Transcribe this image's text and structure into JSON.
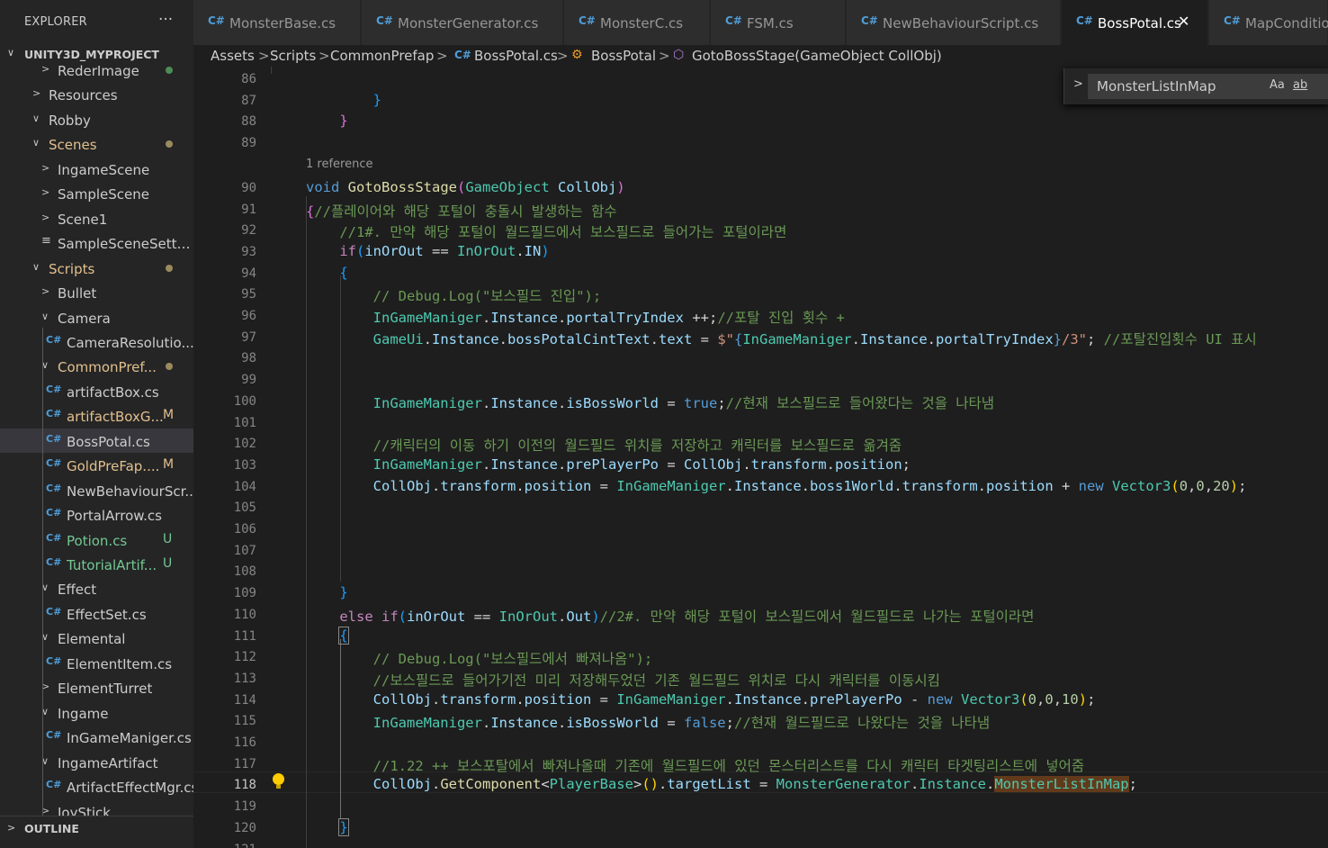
{
  "explorer": {
    "title": "EXPLORER",
    "more": "···",
    "root": "UNITY3D_MYPROJECT",
    "items": [
      {
        "label": "RederImage",
        "type": "folder",
        "open": false,
        "dot": "green"
      },
      {
        "label": "Resources",
        "type": "folder",
        "open": false
      },
      {
        "label": "Robby",
        "type": "folder",
        "open": true
      },
      {
        "label": "Scenes",
        "type": "folder",
        "open": true,
        "dot": "yellow",
        "status": "mod"
      },
      {
        "label": "IngameScene",
        "type": "folder",
        "open": false
      },
      {
        "label": "SampleScene",
        "type": "folder",
        "open": false
      },
      {
        "label": "Scene1",
        "type": "folder",
        "open": false
      },
      {
        "label": "SampleSceneSettin...",
        "type": "settings"
      },
      {
        "label": "Scripts",
        "type": "folder",
        "open": true,
        "dot": "yellow",
        "status": "mod"
      },
      {
        "label": "Bullet",
        "type": "folder",
        "open": false
      },
      {
        "label": "Camera",
        "type": "folder",
        "open": true
      },
      {
        "label": "CameraResolutio...",
        "type": "cs"
      },
      {
        "label": "CommonPref...",
        "type": "folder",
        "open": true,
        "dot": "yellow",
        "status": "mod"
      },
      {
        "label": "artifactBox.cs",
        "type": "cs"
      },
      {
        "label": "artifactBoxG...",
        "type": "cs",
        "status": "mod",
        "badge": "M"
      },
      {
        "label": "BossPotal.cs",
        "type": "cs",
        "selected": true
      },
      {
        "label": "GoldPreFap....",
        "type": "cs",
        "status": "mod",
        "badge": "M"
      },
      {
        "label": "NewBehaviourScr...",
        "type": "cs"
      },
      {
        "label": "PortalArrow.cs",
        "type": "cs"
      },
      {
        "label": "Potion.cs",
        "type": "cs",
        "status": "unt",
        "badge": "U"
      },
      {
        "label": "TutorialArtif...",
        "type": "cs",
        "status": "unt",
        "badge": "U"
      },
      {
        "label": "Effect",
        "type": "folder",
        "open": true
      },
      {
        "label": "EffectSet.cs",
        "type": "cs"
      },
      {
        "label": "Elemental",
        "type": "folder",
        "open": true
      },
      {
        "label": "ElementItem.cs",
        "type": "cs"
      },
      {
        "label": "ElementTurret",
        "type": "folder",
        "open": false
      },
      {
        "label": "Ingame",
        "type": "folder",
        "open": true
      },
      {
        "label": "InGameManiger.cs",
        "type": "cs"
      },
      {
        "label": "IngameArtifact",
        "type": "folder",
        "open": true
      },
      {
        "label": "ArtifactEffectMgr.cs",
        "type": "cs"
      },
      {
        "label": "JoyStick",
        "type": "folder",
        "open": false
      }
    ],
    "outline": "OUTLINE"
  },
  "tabs": [
    {
      "label": "MonsterBase.cs"
    },
    {
      "label": "MonsterGenerator.cs"
    },
    {
      "label": "MonsterC.cs"
    },
    {
      "label": "FSM.cs"
    },
    {
      "label": "NewBehaviourScript.cs"
    },
    {
      "label": "BossPotal.cs",
      "active": true,
      "close": "✕"
    },
    {
      "label": "MapConditio"
    }
  ],
  "breadcrumb": [
    "Assets",
    "Scripts",
    "CommonPrefap",
    "BossPotal.cs",
    "BossPotal",
    "GotoBossStage(GameObject CollObj)"
  ],
  "find": {
    "value": "MonsterListInMap",
    "match_case": "Aa",
    "whole_word": "ab"
  },
  "editor": {
    "reference_label": "1 reference",
    "current_line": "118",
    "lines": [
      {
        "n": "86",
        "tokens": []
      },
      {
        "n": "87",
        "tokens": [
          {
            "t": "        ",
            "c": "p"
          },
          {
            "t": "}",
            "c": "b3"
          }
        ]
      },
      {
        "n": "88",
        "tokens": [
          {
            "t": "    ",
            "c": "p"
          },
          {
            "t": "}",
            "c": "b2"
          }
        ]
      },
      {
        "n": "89",
        "tokens": []
      },
      {
        "n": "90",
        "tokens": [
          {
            "t": "void",
            "c": "k"
          },
          {
            "t": " ",
            "c": "p"
          },
          {
            "t": "GotoBossStage",
            "c": "f"
          },
          {
            "t": "(",
            "c": "b2"
          },
          {
            "t": "GameObject",
            "c": "t"
          },
          {
            "t": " ",
            "c": "p"
          },
          {
            "t": "CollObj",
            "c": "v"
          },
          {
            "t": ")",
            "c": "b2"
          }
        ]
      },
      {
        "n": "91",
        "tokens": [
          {
            "t": "{",
            "c": "b2"
          },
          {
            "t": "//플레이어와 해당 포털이 충돌시 발생하는 함수",
            "c": "c"
          }
        ]
      },
      {
        "n": "92",
        "tokens": [
          {
            "t": "    ",
            "c": "p"
          },
          {
            "t": "//1#. 만약 해당 포털이 월드필드에서 보스필드로 들어가는 포털이라면",
            "c": "c"
          }
        ]
      },
      {
        "n": "93",
        "tokens": [
          {
            "t": "    ",
            "c": "p"
          },
          {
            "t": "if",
            "c": "cf"
          },
          {
            "t": "(",
            "c": "b3"
          },
          {
            "t": "inOrOut",
            "c": "v"
          },
          {
            "t": " == ",
            "c": "p"
          },
          {
            "t": "InOrOut",
            "c": "t"
          },
          {
            "t": ".",
            "c": "p"
          },
          {
            "t": "IN",
            "c": "v"
          },
          {
            "t": ")",
            "c": "b3"
          }
        ]
      },
      {
        "n": "94",
        "tokens": [
          {
            "t": "    ",
            "c": "p"
          },
          {
            "t": "{",
            "c": "b3"
          }
        ]
      },
      {
        "n": "95",
        "tokens": [
          {
            "t": "        ",
            "c": "p"
          },
          {
            "t": "// Debug.Log(\"보스필드 진입\");",
            "c": "c"
          }
        ]
      },
      {
        "n": "96",
        "tokens": [
          {
            "t": "        ",
            "c": "p"
          },
          {
            "t": "InGameManiger",
            "c": "t"
          },
          {
            "t": ".",
            "c": "p"
          },
          {
            "t": "Instance",
            "c": "v"
          },
          {
            "t": ".",
            "c": "p"
          },
          {
            "t": "portalTryIndex",
            "c": "v"
          },
          {
            "t": " ++;",
            "c": "p"
          },
          {
            "t": "//포탈 진입 횟수 +",
            "c": "c"
          }
        ]
      },
      {
        "n": "97",
        "tokens": [
          {
            "t": "        ",
            "c": "p"
          },
          {
            "t": "GameUi",
            "c": "t"
          },
          {
            "t": ".",
            "c": "p"
          },
          {
            "t": "Instance",
            "c": "v"
          },
          {
            "t": ".",
            "c": "p"
          },
          {
            "t": "bossPotalCintText",
            "c": "v"
          },
          {
            "t": ".",
            "c": "p"
          },
          {
            "t": "text",
            "c": "v"
          },
          {
            "t": " = ",
            "c": "p"
          },
          {
            "t": "$\"",
            "c": "s"
          },
          {
            "t": "{",
            "c": "k"
          },
          {
            "t": "InGameManiger",
            "c": "t"
          },
          {
            "t": ".",
            "c": "p"
          },
          {
            "t": "Instance",
            "c": "v"
          },
          {
            "t": ".",
            "c": "p"
          },
          {
            "t": "portalTryIndex",
            "c": "v"
          },
          {
            "t": "}",
            "c": "k"
          },
          {
            "t": "/3\"",
            "c": "s"
          },
          {
            "t": "; ",
            "c": "p"
          },
          {
            "t": "//포탈진입횟수 UI 표시",
            "c": "c"
          }
        ]
      },
      {
        "n": "98",
        "tokens": []
      },
      {
        "n": "99",
        "tokens": []
      },
      {
        "n": "100",
        "tokens": [
          {
            "t": "        ",
            "c": "p"
          },
          {
            "t": "InGameManiger",
            "c": "t"
          },
          {
            "t": ".",
            "c": "p"
          },
          {
            "t": "Instance",
            "c": "v"
          },
          {
            "t": ".",
            "c": "p"
          },
          {
            "t": "isBossWorld",
            "c": "v"
          },
          {
            "t": " = ",
            "c": "p"
          },
          {
            "t": "true",
            "c": "k"
          },
          {
            "t": ";",
            "c": "p"
          },
          {
            "t": "//현재 보스필드로 들어왔다는 것을 나타냄",
            "c": "c"
          }
        ]
      },
      {
        "n": "101",
        "tokens": []
      },
      {
        "n": "102",
        "tokens": [
          {
            "t": "        ",
            "c": "p"
          },
          {
            "t": "//캐릭터의 이동 하기 이전의 월드필드 위치를 저장하고 캐릭터를 보스필드로 옮겨줌",
            "c": "c"
          }
        ]
      },
      {
        "n": "103",
        "tokens": [
          {
            "t": "        ",
            "c": "p"
          },
          {
            "t": "InGameManiger",
            "c": "t"
          },
          {
            "t": ".",
            "c": "p"
          },
          {
            "t": "Instance",
            "c": "v"
          },
          {
            "t": ".",
            "c": "p"
          },
          {
            "t": "prePlayerPo",
            "c": "v"
          },
          {
            "t": " = ",
            "c": "p"
          },
          {
            "t": "CollObj",
            "c": "v"
          },
          {
            "t": ".",
            "c": "p"
          },
          {
            "t": "transform",
            "c": "v"
          },
          {
            "t": ".",
            "c": "p"
          },
          {
            "t": "position",
            "c": "v"
          },
          {
            "t": ";",
            "c": "p"
          }
        ]
      },
      {
        "n": "104",
        "tokens": [
          {
            "t": "        ",
            "c": "p"
          },
          {
            "t": "CollObj",
            "c": "v"
          },
          {
            "t": ".",
            "c": "p"
          },
          {
            "t": "transform",
            "c": "v"
          },
          {
            "t": ".",
            "c": "p"
          },
          {
            "t": "position",
            "c": "v"
          },
          {
            "t": " = ",
            "c": "p"
          },
          {
            "t": "InGameManiger",
            "c": "t"
          },
          {
            "t": ".",
            "c": "p"
          },
          {
            "t": "Instance",
            "c": "v"
          },
          {
            "t": ".",
            "c": "p"
          },
          {
            "t": "boss1World",
            "c": "v"
          },
          {
            "t": ".",
            "c": "p"
          },
          {
            "t": "transform",
            "c": "v"
          },
          {
            "t": ".",
            "c": "p"
          },
          {
            "t": "position",
            "c": "v"
          },
          {
            "t": " + ",
            "c": "p"
          },
          {
            "t": "new",
            "c": "k"
          },
          {
            "t": " ",
            "c": "p"
          },
          {
            "t": "Vector3",
            "c": "t"
          },
          {
            "t": "(",
            "c": "b1"
          },
          {
            "t": "0",
            "c": "n"
          },
          {
            "t": ",",
            "c": "p"
          },
          {
            "t": "0",
            "c": "n"
          },
          {
            "t": ",",
            "c": "p"
          },
          {
            "t": "20",
            "c": "n"
          },
          {
            "t": ")",
            "c": "b1"
          },
          {
            "t": ";",
            "c": "p"
          }
        ]
      },
      {
        "n": "105",
        "tokens": []
      },
      {
        "n": "106",
        "tokens": []
      },
      {
        "n": "107",
        "tokens": []
      },
      {
        "n": "108",
        "tokens": []
      },
      {
        "n": "109",
        "tokens": [
          {
            "t": "    ",
            "c": "p"
          },
          {
            "t": "}",
            "c": "b3"
          }
        ]
      },
      {
        "n": "110",
        "tokens": [
          {
            "t": "    ",
            "c": "p"
          },
          {
            "t": "else",
            "c": "cf"
          },
          {
            "t": " ",
            "c": "p"
          },
          {
            "t": "if",
            "c": "cf"
          },
          {
            "t": "(",
            "c": "b3"
          },
          {
            "t": "inOrOut",
            "c": "v"
          },
          {
            "t": " == ",
            "c": "p"
          },
          {
            "t": "InOrOut",
            "c": "t"
          },
          {
            "t": ".",
            "c": "p"
          },
          {
            "t": "Out",
            "c": "v"
          },
          {
            "t": ")",
            "c": "b3"
          },
          {
            "t": "//2#. 만약 해당 포털이 보스필드에서 월드필드로 나가는 포털이라면",
            "c": "c"
          }
        ]
      },
      {
        "n": "111",
        "tokens": [
          {
            "t": "    ",
            "c": "p"
          },
          {
            "t": "{",
            "c": "b3 box"
          }
        ]
      },
      {
        "n": "112",
        "tokens": [
          {
            "t": "        ",
            "c": "p"
          },
          {
            "t": "// Debug.Log(\"보스필드에서 빠져나옴\");",
            "c": "c"
          }
        ]
      },
      {
        "n": "113",
        "tokens": [
          {
            "t": "        ",
            "c": "p"
          },
          {
            "t": "//보스필드로 들어가기전 미리 저장해두었던 기존 월드필드 위치로 다시 캐릭터를 이동시킴",
            "c": "c"
          }
        ]
      },
      {
        "n": "114",
        "tokens": [
          {
            "t": "        ",
            "c": "p"
          },
          {
            "t": "CollObj",
            "c": "v"
          },
          {
            "t": ".",
            "c": "p"
          },
          {
            "t": "transform",
            "c": "v"
          },
          {
            "t": ".",
            "c": "p"
          },
          {
            "t": "position",
            "c": "v"
          },
          {
            "t": " = ",
            "c": "p"
          },
          {
            "t": "InGameManiger",
            "c": "t"
          },
          {
            "t": ".",
            "c": "p"
          },
          {
            "t": "Instance",
            "c": "v"
          },
          {
            "t": ".",
            "c": "p"
          },
          {
            "t": "prePlayerPo",
            "c": "v"
          },
          {
            "t": " - ",
            "c": "p"
          },
          {
            "t": "new",
            "c": "k"
          },
          {
            "t": " ",
            "c": "p"
          },
          {
            "t": "Vector3",
            "c": "t"
          },
          {
            "t": "(",
            "c": "b1"
          },
          {
            "t": "0",
            "c": "n"
          },
          {
            "t": ",",
            "c": "p"
          },
          {
            "t": "0",
            "c": "n"
          },
          {
            "t": ",",
            "c": "p"
          },
          {
            "t": "10",
            "c": "n"
          },
          {
            "t": ")",
            "c": "b1"
          },
          {
            "t": ";",
            "c": "p"
          }
        ]
      },
      {
        "n": "115",
        "tokens": [
          {
            "t": "        ",
            "c": "p"
          },
          {
            "t": "InGameManiger",
            "c": "t"
          },
          {
            "t": ".",
            "c": "p"
          },
          {
            "t": "Instance",
            "c": "v"
          },
          {
            "t": ".",
            "c": "p"
          },
          {
            "t": "isBossWorld",
            "c": "v"
          },
          {
            "t": " = ",
            "c": "p"
          },
          {
            "t": "false",
            "c": "k"
          },
          {
            "t": ";",
            "c": "p"
          },
          {
            "t": "//현재 월드필드로 나왔다는 것을 나타냄",
            "c": "c"
          }
        ]
      },
      {
        "n": "116",
        "tokens": []
      },
      {
        "n": "117",
        "tokens": [
          {
            "t": "        ",
            "c": "p"
          },
          {
            "t": "//1.22 ++ 보스포탈에서 빠져나올때 기존에 월드필드에 있던 몬스터리스트를 다시 캐릭터 타겟팅리스트에 넣어줌",
            "c": "c"
          }
        ]
      },
      {
        "n": "118",
        "tokens": [
          {
            "t": "        ",
            "c": "p"
          },
          {
            "t": "CollObj",
            "c": "v"
          },
          {
            "t": ".",
            "c": "p"
          },
          {
            "t": "GetComponent",
            "c": "f"
          },
          {
            "t": "<",
            "c": "p"
          },
          {
            "t": "PlayerBase",
            "c": "t"
          },
          {
            "t": ">",
            "c": "p"
          },
          {
            "t": "()",
            "c": "b1"
          },
          {
            "t": ".",
            "c": "p"
          },
          {
            "t": "targetList",
            "c": "v"
          },
          {
            "t": " = ",
            "c": "p"
          },
          {
            "t": "MonsterGenerator",
            "c": "t"
          },
          {
            "t": ".",
            "c": "p"
          },
          {
            "t": "Instance",
            "c": "t"
          },
          {
            "t": ".",
            "c": "p"
          },
          {
            "t": "MonsterListInMap",
            "c": "hl"
          },
          {
            "t": ";",
            "c": "p"
          }
        ]
      },
      {
        "n": "119",
        "tokens": []
      },
      {
        "n": "120",
        "tokens": [
          {
            "t": "    ",
            "c": "p"
          },
          {
            "t": "}",
            "c": "b3 box"
          }
        ]
      },
      {
        "n": "121",
        "tokens": []
      }
    ]
  }
}
